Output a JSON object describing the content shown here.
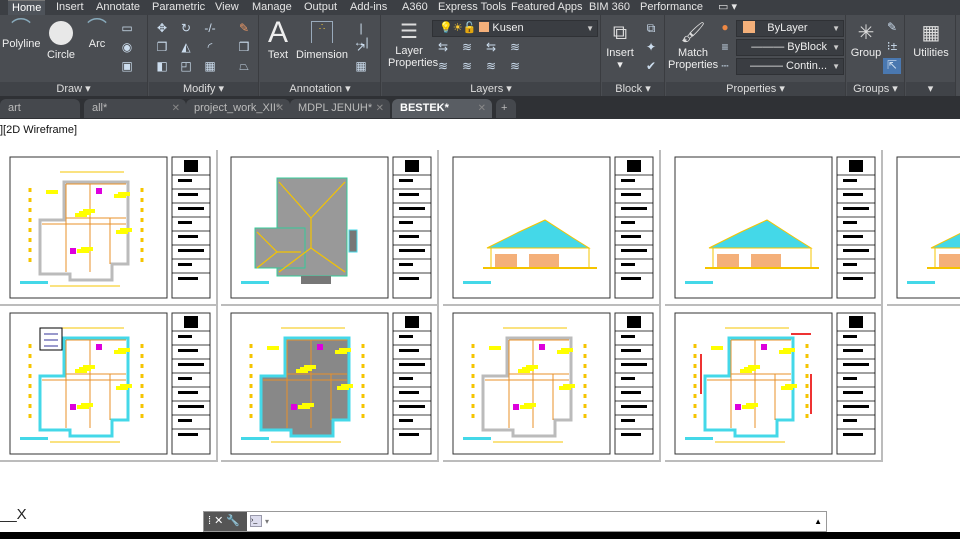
{
  "ribbon_tabs": [
    "Home",
    "Insert",
    "Annotate",
    "Parametric",
    "View",
    "Manage",
    "Output",
    "Add-ins",
    "A360",
    "Express Tools",
    "Featured Apps",
    "BIM 360",
    "Performance"
  ],
  "active_ribbon_tab": "Home",
  "panels": {
    "draw": {
      "label": "Draw",
      "polyline": "Polyline",
      "circle": "Circle",
      "arc": "Arc"
    },
    "modify": {
      "label": "Modify"
    },
    "annotation": {
      "label": "Annotation",
      "text": "Text",
      "dimension": "Dimension"
    },
    "layers": {
      "label": "Layers",
      "layer_properties_1": "Layer",
      "layer_properties_2": "Properties",
      "current_layer": "Kusen",
      "layer_color": "#f4b07a"
    },
    "block": {
      "label": "Block",
      "insert": "Insert"
    },
    "properties": {
      "label": "Properties",
      "match_1": "Match",
      "match_2": "Properties",
      "color": "ByLayer",
      "color_swatch": "#f4b07a",
      "lineweight": "ByBlock",
      "linetype": "Contin..."
    },
    "groups": {
      "label": "Groups",
      "group": "Group"
    },
    "utilities": {
      "label": "Utilities"
    }
  },
  "doc_tabs": [
    {
      "label": "art",
      "active": false,
      "close": false
    },
    {
      "label": "all*",
      "active": false,
      "close": true
    },
    {
      "label": "project_work_XII*",
      "active": false,
      "close": true
    },
    {
      "label": "MDPL JENUH*",
      "active": false,
      "close": true
    },
    {
      "label": "BESTEK*",
      "active": true,
      "close": true
    }
  ],
  "new_tab": "+",
  "viewport_label": "][2D Wireframe]",
  "sheets": [
    {
      "type": "floor-plan"
    },
    {
      "type": "roof-plan"
    },
    {
      "type": "elevation"
    },
    {
      "type": "elevation"
    },
    {
      "type": "elevation"
    },
    {
      "type": "furniture-plan"
    },
    {
      "type": "ceiling-plan"
    },
    {
      "type": "floor-plan"
    },
    {
      "type": "electrical-plan"
    }
  ],
  "command_line": {
    "value": "",
    "close": "✕"
  },
  "colors": {
    "ribbon": "#4a4d52",
    "tabbar": "#3c3f44",
    "drawing_yellow": "#f5c400",
    "roof_cyan": "#44d8e8"
  }
}
